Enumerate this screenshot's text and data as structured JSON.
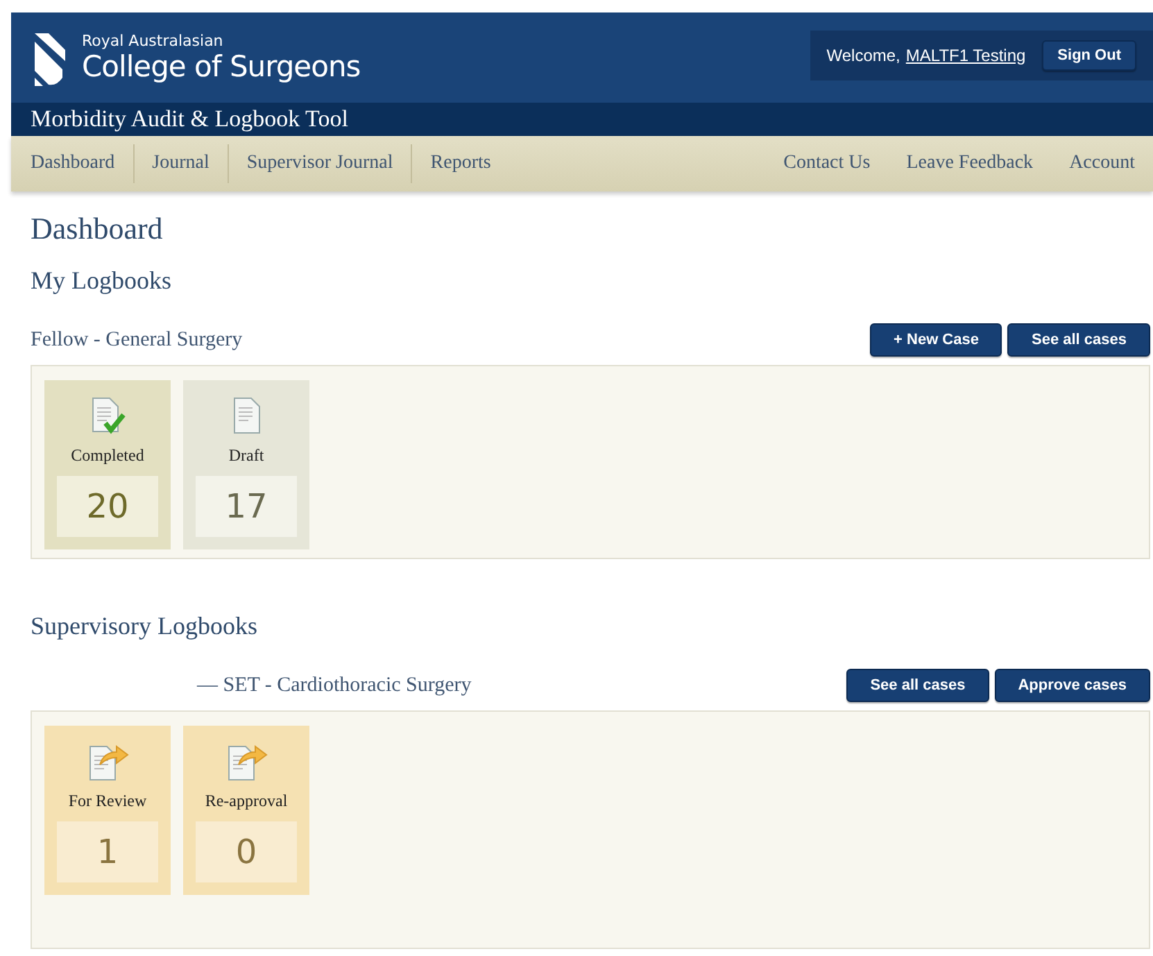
{
  "header": {
    "logo_small": "Royal Australasian",
    "logo_large": "College of Surgeons",
    "welcome": "Welcome,",
    "user": "MALTF1 Testing",
    "sign_out": "Sign Out",
    "app_title": "Morbidity Audit & Logbook Tool"
  },
  "nav_left": [
    {
      "label": "Dashboard"
    },
    {
      "label": "Journal"
    },
    {
      "label": "Supervisor Journal"
    },
    {
      "label": "Reports"
    }
  ],
  "nav_right": [
    {
      "label": "Contact Us"
    },
    {
      "label": "Leave Feedback"
    },
    {
      "label": "Account"
    }
  ],
  "page_title": "Dashboard",
  "sections": [
    {
      "title": "My Logbooks",
      "groups": [
        {
          "title": "Fellow - General Surgery",
          "indent": false,
          "buttons": [
            "+ New Case",
            "See all cases"
          ],
          "tiles": [
            {
              "kind": "completed",
              "label": "Completed",
              "count": "20"
            },
            {
              "kind": "draft",
              "label": "Draft",
              "count": "17"
            }
          ]
        }
      ]
    },
    {
      "title": "Supervisory Logbooks",
      "groups": [
        {
          "title": "— SET - Cardiothoracic Surgery",
          "indent": true,
          "buttons": [
            "See all cases",
            "Approve cases"
          ],
          "tiles": [
            {
              "kind": "review",
              "label": "For Review",
              "count": "1"
            },
            {
              "kind": "review",
              "label": "Re-approval",
              "count": "0"
            }
          ]
        }
      ]
    }
  ]
}
